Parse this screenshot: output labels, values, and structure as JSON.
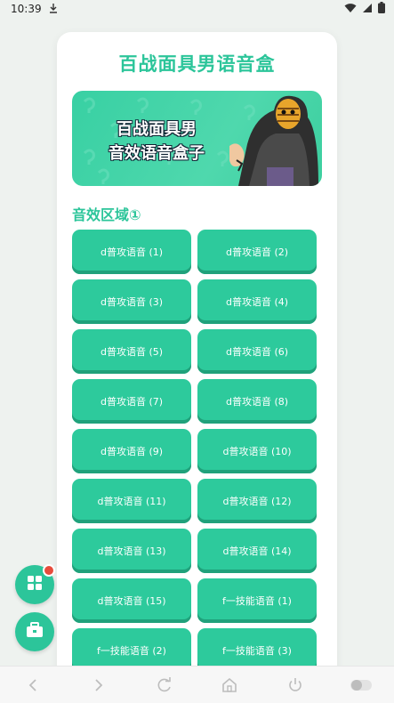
{
  "status": {
    "time": "10:39"
  },
  "app": {
    "title": "百战面具男语音盒"
  },
  "banner": {
    "line1": "百战面具男",
    "line2": "音效语音盒子"
  },
  "section": {
    "title": "音效区域①"
  },
  "buttons": [
    "d普攻语音 (1)",
    "d普攻语音 (2)",
    "d普攻语音 (3)",
    "d普攻语音 (4)",
    "d普攻语音 (5)",
    "d普攻语音 (6)",
    "d普攻语音 (7)",
    "d普攻语音 (8)",
    "d普攻语音 (9)",
    "d普攻语音 (10)",
    "d普攻语音 (11)",
    "d普攻语音 (12)",
    "d普攻语音 (13)",
    "d普攻语音 (14)",
    "d普攻语音 (15)",
    "f一技能语音 (1)",
    "f一技能语音 (2)",
    "f一技能语音 (3)"
  ],
  "colors": {
    "accent": "#2cc59a",
    "button": "#2dca9c",
    "badge": "#e74c3c"
  },
  "icons": {
    "fab_top": "grid-icon",
    "fab_bottom": "toolbox-icon",
    "nav": [
      "back-icon",
      "forward-icon",
      "refresh-icon",
      "home-icon",
      "power-icon",
      "toggle-icon"
    ]
  }
}
